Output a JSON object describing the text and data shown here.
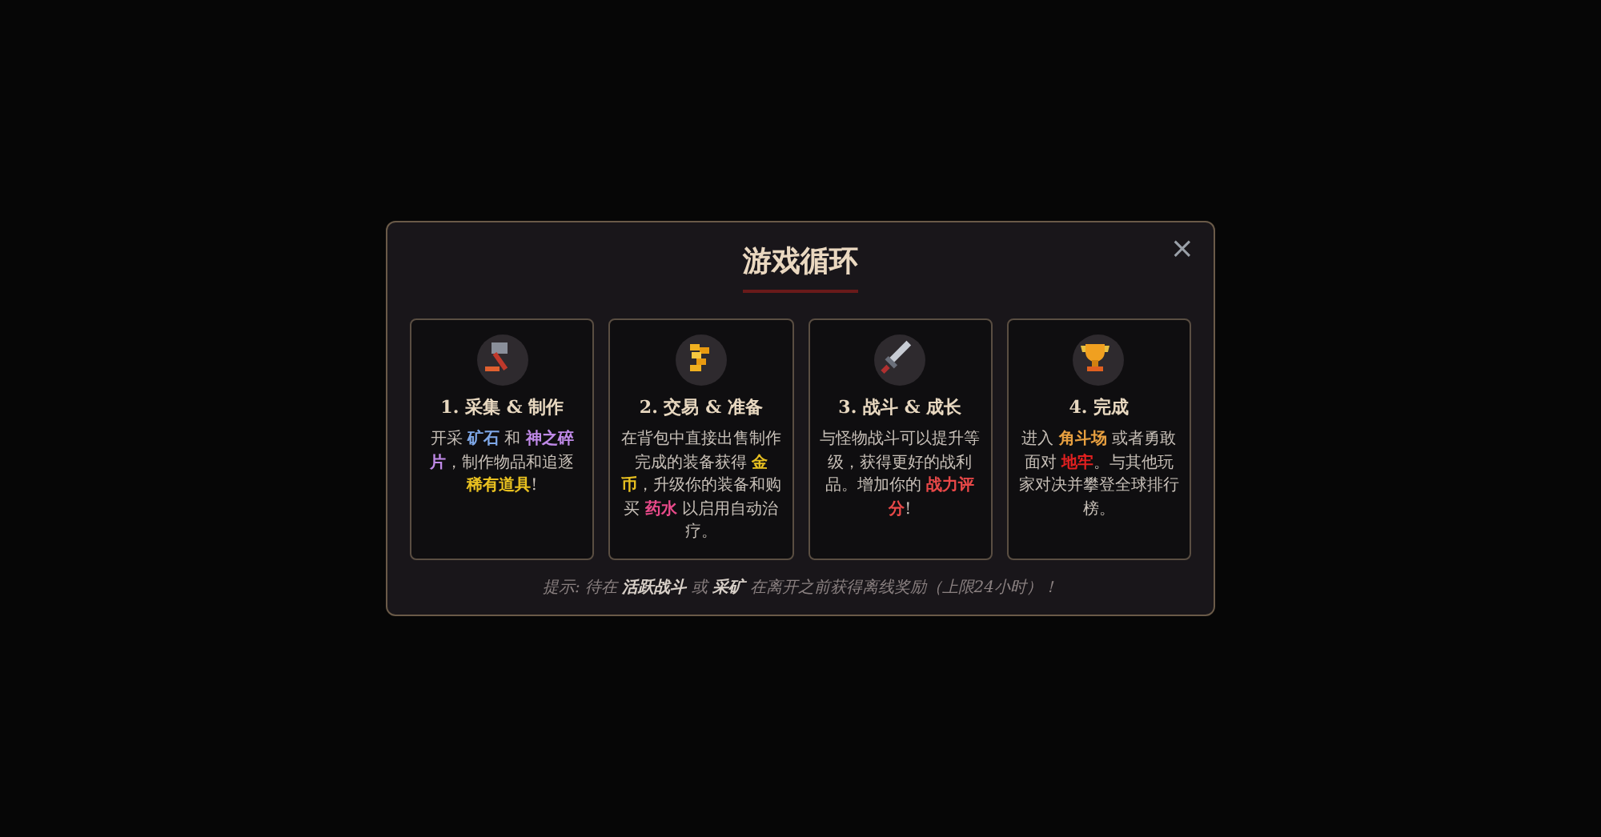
{
  "dialog": {
    "title": "游戏循环",
    "close": "×",
    "steps": [
      {
        "title": "1. 采集 & 制作",
        "text": [
          {
            "text": "开采 "
          },
          {
            "text": "矿石",
            "color": "#7fa8e8"
          },
          {
            "text": " 和 "
          },
          {
            "text": "神之碎片",
            "color": "#c08ae8"
          },
          {
            "text": "，制作物品和追逐 "
          },
          {
            "text": "稀有道具",
            "color": "#e8c020"
          },
          {
            "text": "!"
          }
        ]
      },
      {
        "title": "2. 交易 & 准备",
        "text": [
          {
            "text": "在背包中直接出售制作完成的装备获得 "
          },
          {
            "text": "金币",
            "color": "#e8c020"
          },
          {
            "text": "，升级你的装备和购买 "
          },
          {
            "text": "药水",
            "color": "#e84a8a"
          },
          {
            "text": " 以启用自动治疗。"
          }
        ]
      },
      {
        "title": "3. 战斗 & 成长",
        "text": [
          {
            "text": "与怪物战斗可以提升等级，获得更好的战利品。增加你的 "
          },
          {
            "text": "战力评分",
            "color": "#e84848"
          },
          {
            "text": "!"
          }
        ]
      },
      {
        "title": "4. 完成",
        "text": [
          {
            "text": "进入 "
          },
          {
            "text": "角斗场",
            "color": "#e8a040"
          },
          {
            "text": " 或者勇敢面对 "
          },
          {
            "text": "地牢",
            "color": "#e02020"
          },
          {
            "text": "。与其他玩家对决并攀登全球排行榜。"
          }
        ]
      }
    ],
    "tip": "提示: 待在 **活跃战斗** 或 **采矿** 在离开之前获得离线奖励（上限24小时）！"
  }
}
